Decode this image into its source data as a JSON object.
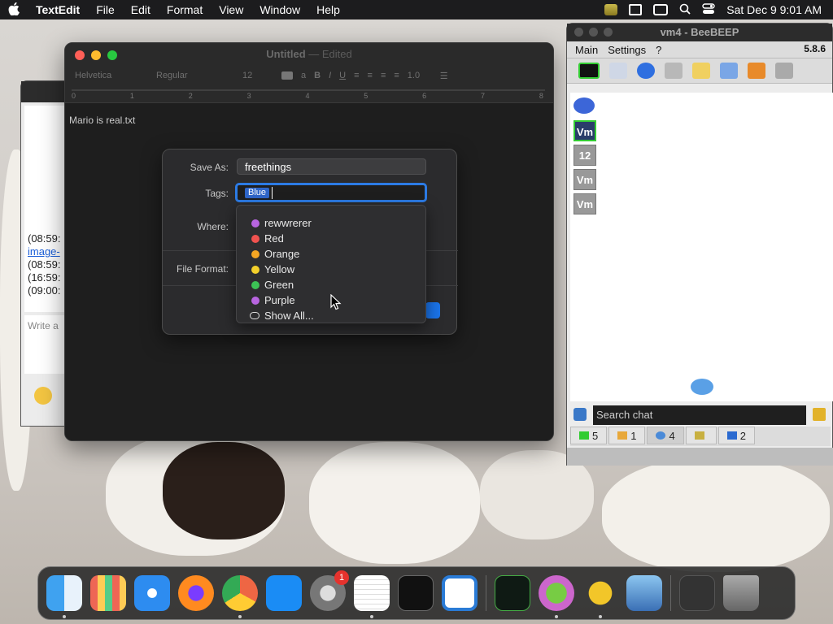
{
  "menubar": {
    "app_name": "TextEdit",
    "menus": [
      "File",
      "Edit",
      "Format",
      "View",
      "Window",
      "Help"
    ],
    "clock": "Sat Dec 9  9:01 AM"
  },
  "textedit": {
    "title": "Untitled",
    "title_suffix": "— Edited",
    "toolbar": {
      "font": "Helvetica",
      "style": "Regular",
      "size": "12",
      "spacing": "1.0"
    },
    "ruler_marks": [
      "0",
      "1",
      "2",
      "3",
      "4",
      "5",
      "6",
      "7",
      "8"
    ],
    "document_text": "Mario is real.txt"
  },
  "save_dialog": {
    "save_as_label": "Save As:",
    "save_as_value": "freethings",
    "tags_label": "Tags:",
    "tag_token": "Blue",
    "where_label": "Where:",
    "file_format_label": "File Format:"
  },
  "tag_popup": {
    "options": [
      {
        "label": "rewwrerer",
        "color": "#b865e0"
      },
      {
        "label": "Red",
        "color": "#f0524f"
      },
      {
        "label": "Orange",
        "color": "#f5a623"
      },
      {
        "label": "Yellow",
        "color": "#f3d02b"
      },
      {
        "label": "Green",
        "color": "#3cc255"
      },
      {
        "label": "Purple",
        "color": "#b865e0"
      }
    ],
    "show_all": "Show All..."
  },
  "beebeep": {
    "title": "vm4 - BeeBEEP",
    "menu": [
      "Main",
      "Settings",
      "?"
    ],
    "version": "5.8.6",
    "users": [
      "Vm",
      "12",
      "Vm",
      "Vm"
    ],
    "search_placeholder": "Search chat",
    "counts": [
      "5",
      "1",
      "4",
      "",
      "2"
    ]
  },
  "chat_left": {
    "lines": [
      "(08:59:",
      "image-",
      "(08:59:",
      "(16:59:",
      "(09:00:"
    ],
    "input_placeholder": "Write a"
  },
  "dock": {
    "apps": [
      "Finder",
      "Launchpad",
      "Safari",
      "Firefox",
      "Chrome",
      "App Store",
      "System Settings",
      "TextEdit",
      "Terminal",
      "VS Code",
      "Activity Monitor",
      "Migration",
      "BeeBEEP",
      "Preview",
      "Downloads",
      "Trash"
    ],
    "settings_badge": "1"
  }
}
